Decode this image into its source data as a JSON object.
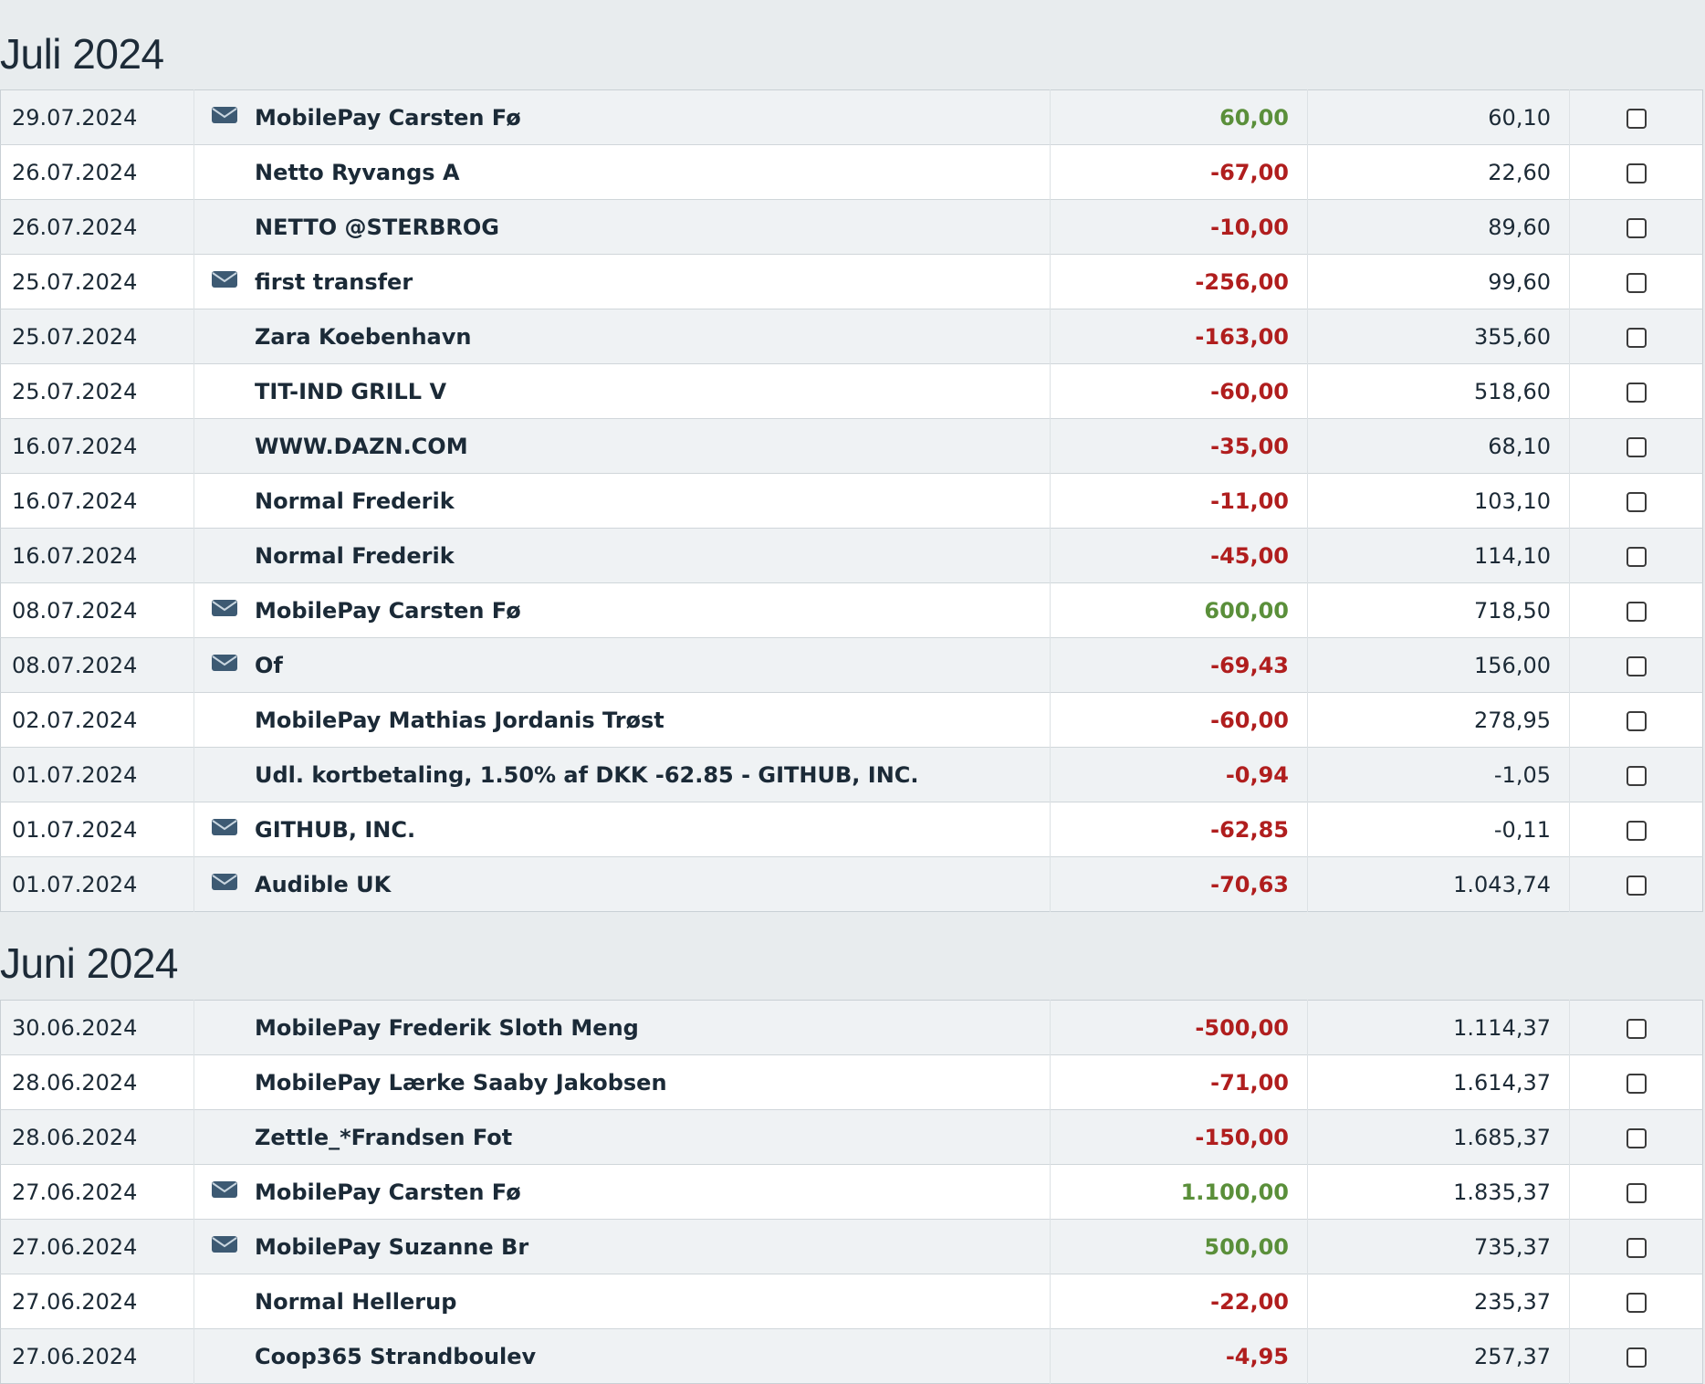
{
  "sections": [
    {
      "title": "Juli 2024",
      "rows": [
        {
          "date": "29.07.2024",
          "has_message": true,
          "text": "MobilePay Carsten Fø",
          "amount": "60,00",
          "sign": "pos",
          "balance": "60,10"
        },
        {
          "date": "26.07.2024",
          "has_message": false,
          "text": "Netto Ryvangs A",
          "amount": "-67,00",
          "sign": "neg",
          "balance": "22,60"
        },
        {
          "date": "26.07.2024",
          "has_message": false,
          "text": "NETTO @STERBROG",
          "amount": "-10,00",
          "sign": "neg",
          "balance": "89,60"
        },
        {
          "date": "25.07.2024",
          "has_message": true,
          "text": "first transfer",
          "amount": "-256,00",
          "sign": "neg",
          "balance": "99,60"
        },
        {
          "date": "25.07.2024",
          "has_message": false,
          "text": "Zara Koebenhavn",
          "amount": "-163,00",
          "sign": "neg",
          "balance": "355,60"
        },
        {
          "date": "25.07.2024",
          "has_message": false,
          "text": "TIT-IND GRILL V",
          "amount": "-60,00",
          "sign": "neg",
          "balance": "518,60"
        },
        {
          "date": "16.07.2024",
          "has_message": false,
          "text": "WWW.DAZN.COM",
          "amount": "-35,00",
          "sign": "neg",
          "balance": "68,10"
        },
        {
          "date": "16.07.2024",
          "has_message": false,
          "text": "Normal Frederik",
          "amount": "-11,00",
          "sign": "neg",
          "balance": "103,10"
        },
        {
          "date": "16.07.2024",
          "has_message": false,
          "text": "Normal Frederik",
          "amount": "-45,00",
          "sign": "neg",
          "balance": "114,10"
        },
        {
          "date": "08.07.2024",
          "has_message": true,
          "text": "MobilePay Carsten Fø",
          "amount": "600,00",
          "sign": "pos",
          "balance": "718,50"
        },
        {
          "date": "08.07.2024",
          "has_message": true,
          "text": "Of",
          "amount": "-69,43",
          "sign": "neg",
          "balance": "156,00"
        },
        {
          "date": "02.07.2024",
          "has_message": false,
          "text": "MobilePay Mathias Jordanis Trøst",
          "amount": "-60,00",
          "sign": "neg",
          "balance": "278,95"
        },
        {
          "date": "01.07.2024",
          "has_message": false,
          "text": "Udl. kortbetaling, 1.50% af DKK -62.85 - GITHUB, INC.",
          "amount": "-0,94",
          "sign": "neg",
          "balance": "-1,05"
        },
        {
          "date": "01.07.2024",
          "has_message": true,
          "text": "GITHUB, INC.",
          "amount": "-62,85",
          "sign": "neg",
          "balance": "-0,11"
        },
        {
          "date": "01.07.2024",
          "has_message": true,
          "text": "Audible UK",
          "amount": "-70,63",
          "sign": "neg",
          "balance": "1.043,74"
        }
      ]
    },
    {
      "title": "Juni 2024",
      "rows": [
        {
          "date": "30.06.2024",
          "has_message": false,
          "text": "MobilePay Frederik Sloth Meng",
          "amount": "-500,00",
          "sign": "neg",
          "balance": "1.114,37"
        },
        {
          "date": "28.06.2024",
          "has_message": false,
          "text": "MobilePay Lærke Saaby Jakobsen",
          "amount": "-71,00",
          "sign": "neg",
          "balance": "1.614,37"
        },
        {
          "date": "28.06.2024",
          "has_message": false,
          "text": "Zettle_*Frandsen Fot",
          "amount": "-150,00",
          "sign": "neg",
          "balance": "1.685,37"
        },
        {
          "date": "27.06.2024",
          "has_message": true,
          "text": "MobilePay Carsten Fø",
          "amount": "1.100,00",
          "sign": "pos",
          "balance": "1.835,37"
        },
        {
          "date": "27.06.2024",
          "has_message": true,
          "text": "MobilePay Suzanne Br",
          "amount": "500,00",
          "sign": "pos",
          "balance": "735,37"
        },
        {
          "date": "27.06.2024",
          "has_message": false,
          "text": "Normal Hellerup",
          "amount": "-22,00",
          "sign": "neg",
          "balance": "235,37"
        },
        {
          "date": "27.06.2024",
          "has_message": false,
          "text": "Coop365 Strandboulev",
          "amount": "-4,95",
          "sign": "neg",
          "balance": "257,37"
        }
      ]
    }
  ],
  "icons": {
    "message": "envelope-icon"
  },
  "colors": {
    "positive": "#5a8f3a",
    "negative": "#b01e1e",
    "icon": "#3d5a73"
  }
}
